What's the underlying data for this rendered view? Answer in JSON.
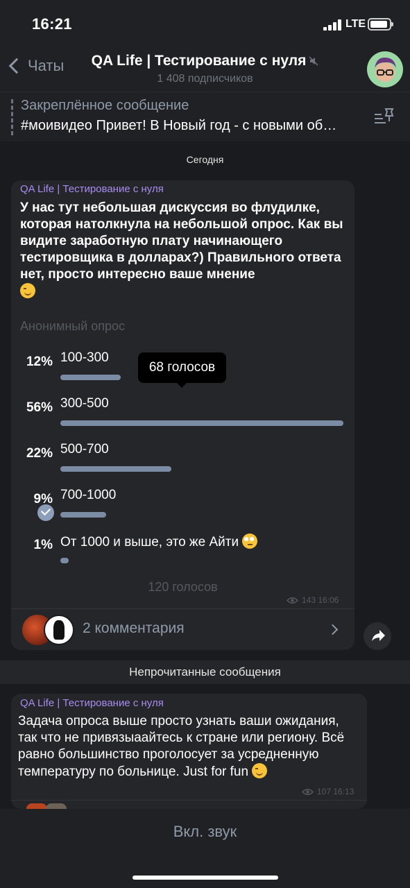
{
  "status_bar": {
    "time": "16:21",
    "network": "LTE"
  },
  "nav": {
    "back_label": "Чаты",
    "title": "QA Life | Тестирование с нуля",
    "subscribers": "1 408 подписчиков"
  },
  "pinned": {
    "title": "Закреплённое сообщение",
    "text": "#моивидео Привет! В Новый год -  с новыми об…"
  },
  "date_separator": "Сегодня",
  "poll_message": {
    "sender": "QA Life | Тестирование с нуля",
    "question": "У нас тут  небольшая дискуссия  во флудилке, которая натолкнула на небольшой опрос. Как вы видите заработную плату начинающего тестировщика в долларах?) Правильного ответа нет, просто интересно ваше мнение",
    "poll_type": "Анонимный опрос",
    "options": [
      {
        "percent_label": "12%",
        "label": "100-300",
        "percent": 12,
        "selected": false
      },
      {
        "percent_label": "56%",
        "label": "300-500",
        "percent": 56,
        "selected": false
      },
      {
        "percent_label": "22%",
        "label": "500-700",
        "percent": 22,
        "selected": false
      },
      {
        "percent_label": "9%",
        "label": "700-1000",
        "percent": 9,
        "selected": true
      },
      {
        "percent_label": "1%",
        "label": "От 1000 и выше, это же Айти",
        "percent": 1,
        "selected": false
      }
    ],
    "tooltip": "68 голосов",
    "total_votes": "120 голосов",
    "views": "143",
    "time": "16:06",
    "comments": "2 комментария"
  },
  "unread_separator": "Непрочитанные сообщения",
  "second_message": {
    "sender": "QA Life | Тестирование с нуля",
    "text": "Задача опроса выше просто узнать ваши ожидания, так что не привязыаайтесь к стране или региону. Всё равно большинство проголосует за усредненную температуру по больнице. Just for fun",
    "views": "107",
    "time": "16:13"
  },
  "bottom": {
    "sound_button": "Вкл. звук"
  },
  "colors": {
    "accent": "#a98cf0",
    "bar": "#7b8ba4",
    "background": "#1a1b1e",
    "bubble": "#252629"
  }
}
